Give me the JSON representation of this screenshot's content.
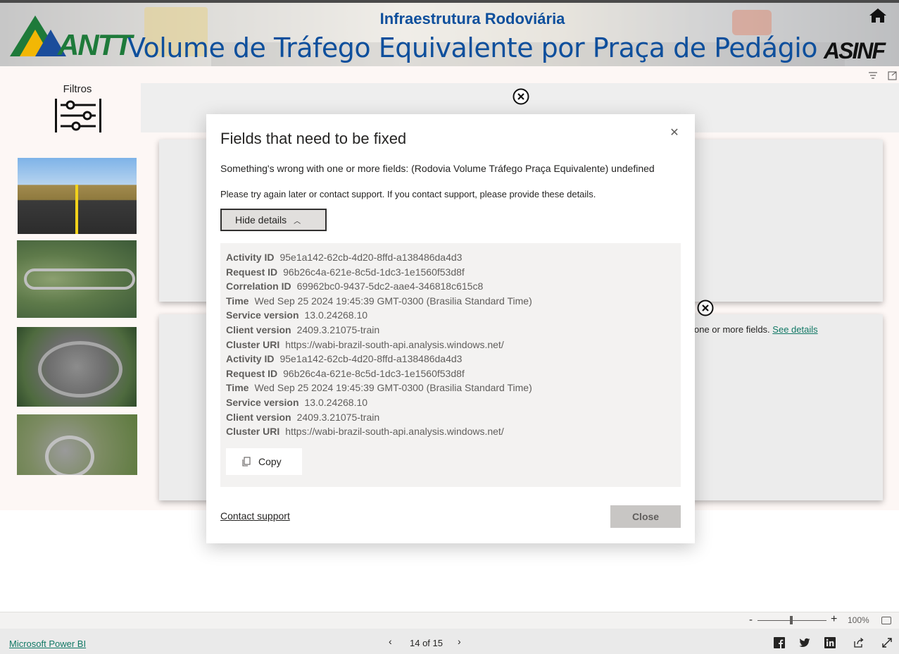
{
  "header": {
    "subtitle": "Infraestrutura Rodoviária",
    "title": "Volume de Tráfego Equivalente por Praça de Pedágio",
    "logo_left": "ANTT",
    "logo_right": "ASINF"
  },
  "sidebar": {
    "filters_label": "Filtros"
  },
  "visual_error": {
    "message": "one or more fields.",
    "link": "See details"
  },
  "dialog": {
    "title": "Fields that need to be fixed",
    "message": "Something's wrong with one or more fields: (Rodovia Volume Tráfego Praça Equivalente) undefined",
    "support_message": "Please try again later or contact support. If you contact support, please provide these details.",
    "hide_details_label": "Hide details",
    "details": [
      {
        "key": "Activity ID",
        "value": "95e1a142-62cb-4d20-8ffd-a138486da4d3"
      },
      {
        "key": "Request ID",
        "value": "96b26c4a-621e-8c5d-1dc3-1e1560f53d8f"
      },
      {
        "key": "Correlation ID",
        "value": "69962bc0-9437-5dc2-aae4-346818c615c8"
      },
      {
        "key": "Time",
        "value": "Wed Sep 25 2024 19:45:39 GMT-0300 (Brasilia Standard Time)"
      },
      {
        "key": "Service version",
        "value": "13.0.24268.10"
      },
      {
        "key": "Client version",
        "value": "2409.3.21075-train"
      },
      {
        "key": "Cluster URI",
        "value": "https://wabi-brazil-south-api.analysis.windows.net/"
      },
      {
        "key": "Activity ID",
        "value": "95e1a142-62cb-4d20-8ffd-a138486da4d3"
      },
      {
        "key": "Request ID",
        "value": "96b26c4a-621e-8c5d-1dc3-1e1560f53d8f"
      },
      {
        "key": "Time",
        "value": "Wed Sep 25 2024 19:45:39 GMT-0300 (Brasilia Standard Time)"
      },
      {
        "key": "Service version",
        "value": "13.0.24268.10"
      },
      {
        "key": "Client version",
        "value": "2409.3.21075-train"
      },
      {
        "key": "Cluster URI",
        "value": "https://wabi-brazil-south-api.analysis.windows.net/"
      }
    ],
    "copy_label": "Copy",
    "contact_support_label": "Contact support",
    "close_label": "Close"
  },
  "zoom": {
    "minus": "-",
    "plus": "+",
    "percent": "100%"
  },
  "footer": {
    "power_bi_link": "Microsoft Power BI",
    "page_indicator": "14 of 15"
  },
  "colors": {
    "title_blue": "#0e4f9c",
    "link_teal": "#117865",
    "close_button_bg": "#c8c6c4"
  }
}
